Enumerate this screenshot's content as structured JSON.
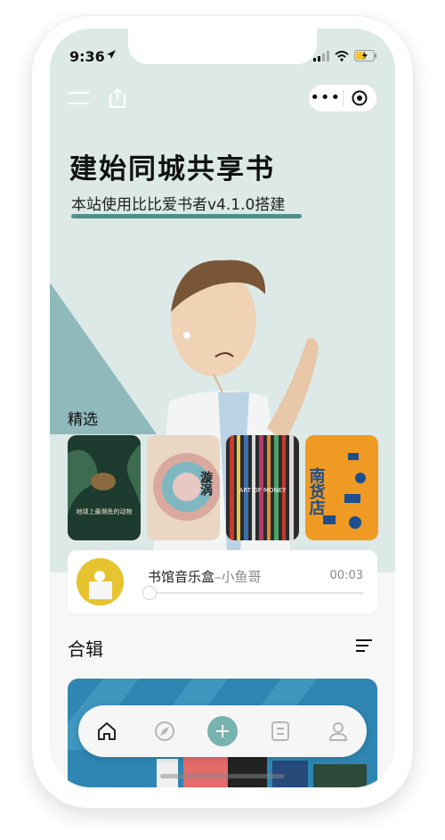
{
  "status": {
    "time": "9:36"
  },
  "header": {
    "title": "建始同城共享书",
    "subtitle": "本站使用比比爱书者v4.1.0搭建"
  },
  "featured": {
    "label": "精选",
    "books": [
      {
        "title": "地球上最濒危的动物",
        "color": "#1d3b2f"
      },
      {
        "title": "漩涡",
        "color": "#e9d6c3"
      },
      {
        "title": "ART OF MONEY",
        "color": "#2b2b2b"
      },
      {
        "title": "南货店",
        "color": "#ef9a22"
      }
    ]
  },
  "player": {
    "track": "书馆音乐盒",
    "artist": "–小鱼哥",
    "time": "00:03",
    "progress": 0
  },
  "albums": {
    "label": "合辑"
  },
  "colors": {
    "accent": "#78b3b0",
    "hero_bg": "#dce9e7",
    "underline": "#4f8f8a"
  },
  "tabbar": {
    "items": [
      "home-icon",
      "compass-icon",
      "plus-icon",
      "list-icon",
      "user-icon"
    ]
  }
}
